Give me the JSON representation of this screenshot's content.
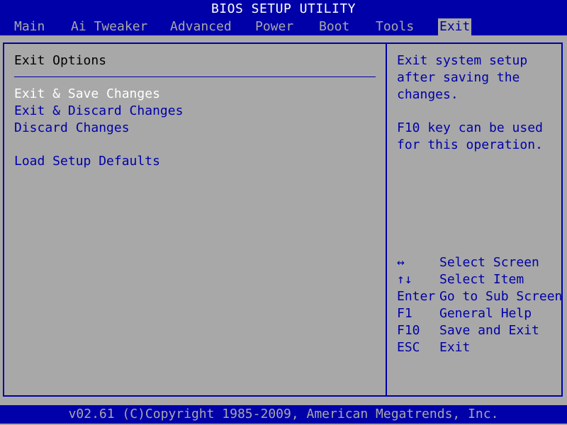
{
  "title": "BIOS SETUP UTILITY",
  "tabs": [
    {
      "label": "Main"
    },
    {
      "label": "Ai Tweaker"
    },
    {
      "label": "Advanced"
    },
    {
      "label": "Power"
    },
    {
      "label": "Boot"
    },
    {
      "label": "Tools"
    },
    {
      "label": "Exit",
      "active": true
    }
  ],
  "left_panel": {
    "title": "Exit Options",
    "items": [
      {
        "label": "Exit & Save Changes",
        "selected": true
      },
      {
        "label": "Exit & Discard Changes"
      },
      {
        "label": "Discard Changes"
      },
      {
        "label": "Load Setup Defaults"
      }
    ]
  },
  "help": {
    "lines": [
      "Exit system setup",
      "after saving the",
      "changes.",
      "F10 key can be used",
      "for this operation."
    ],
    "keys": [
      {
        "key": "↔",
        "desc": "Select Screen"
      },
      {
        "key": "↑↓",
        "desc": "Select Item"
      },
      {
        "key": "Enter",
        "desc": "Go to Sub Screen"
      },
      {
        "key": "F1",
        "desc": "General Help"
      },
      {
        "key": "F10",
        "desc": "Save and Exit"
      },
      {
        "key": "ESC",
        "desc": "Exit"
      }
    ]
  },
  "footer": "v02.61 (C)Copyright 1985-2009, American Megatrends, Inc.",
  "colors": {
    "background": "#a8a8a8",
    "blue": "#0000a8",
    "selected_text": "#ffffff"
  }
}
